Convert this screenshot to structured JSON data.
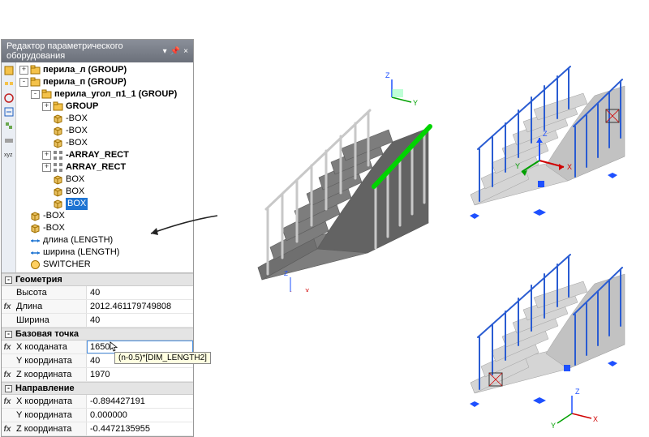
{
  "panel": {
    "title": "Редактор параметрического оборудования",
    "header_btns": {
      "drop": "▾",
      "pin": "📌",
      "close": "×"
    }
  },
  "tree": {
    "rows": [
      {
        "depth": 0,
        "exp": "+",
        "icon": "group",
        "label": "перила_л (GROUP)",
        "bold": true
      },
      {
        "depth": 0,
        "exp": "-",
        "icon": "group",
        "label": "перила_п (GROUP)",
        "bold": true
      },
      {
        "depth": 1,
        "exp": "-",
        "icon": "group",
        "label": "перила_угол_п1_1 (GROUP)",
        "bold": true
      },
      {
        "depth": 2,
        "exp": "+",
        "icon": "group",
        "label": "GROUP",
        "bold": true
      },
      {
        "depth": 2,
        "exp": "",
        "icon": "box",
        "label": "-BOX"
      },
      {
        "depth": 2,
        "exp": "",
        "icon": "box",
        "label": "-BOX"
      },
      {
        "depth": 2,
        "exp": "",
        "icon": "box",
        "label": "-BOX"
      },
      {
        "depth": 2,
        "exp": "+",
        "icon": "array",
        "label": "-ARRAY_RECT",
        "bold": true
      },
      {
        "depth": 2,
        "exp": "+",
        "icon": "array",
        "label": "ARRAY_RECT",
        "bold": true
      },
      {
        "depth": 2,
        "exp": "",
        "icon": "box",
        "label": "BOX"
      },
      {
        "depth": 2,
        "exp": "",
        "icon": "box",
        "label": "BOX"
      },
      {
        "depth": 2,
        "exp": "",
        "icon": "box",
        "label": "BOX",
        "sel": true
      },
      {
        "depth": 0,
        "exp": "",
        "icon": "box",
        "label": "-BOX"
      },
      {
        "depth": 0,
        "exp": "",
        "icon": "box",
        "label": "-BOX"
      },
      {
        "depth": 0,
        "exp": "",
        "icon": "dim",
        "label": "длина (LENGTH)"
      },
      {
        "depth": 0,
        "exp": "",
        "icon": "dim",
        "label": "ширина (LENGTH)"
      },
      {
        "depth": 0,
        "exp": "",
        "icon": "sw",
        "label": "SWITCHER"
      }
    ]
  },
  "props": {
    "sections": {
      "geom": "Геометрия",
      "base": "Базовая точка",
      "dir": "Направление"
    },
    "geom": {
      "height_lbl": "Высота",
      "height": "40",
      "length_lbl": "Длина",
      "length": "2012.461179749808",
      "width_lbl": "Ширина",
      "width": "40"
    },
    "base": {
      "x_lbl": "X кооданата",
      "x": "1650",
      "y_lbl": "Y координата",
      "y": "40",
      "z_lbl": "Z координата",
      "z": "1970",
      "tooltip": "(n-0.5)*[DIM_LENGTH2]"
    },
    "dir": {
      "x_lbl": "X координата",
      "x": "-0.894427191",
      "y_lbl": "Y координата",
      "y": "0.000000",
      "z_lbl": "Z координата",
      "z": "-0.4472135955"
    }
  },
  "axes": {
    "x": "X",
    "y": "Y",
    "z": "Z"
  },
  "colors": {
    "sel": "#1e74d2",
    "highlight": "#00d400",
    "stair": "#7d7d7d",
    "rail": "#d6d6d6",
    "blue": "#2a5cd2"
  }
}
